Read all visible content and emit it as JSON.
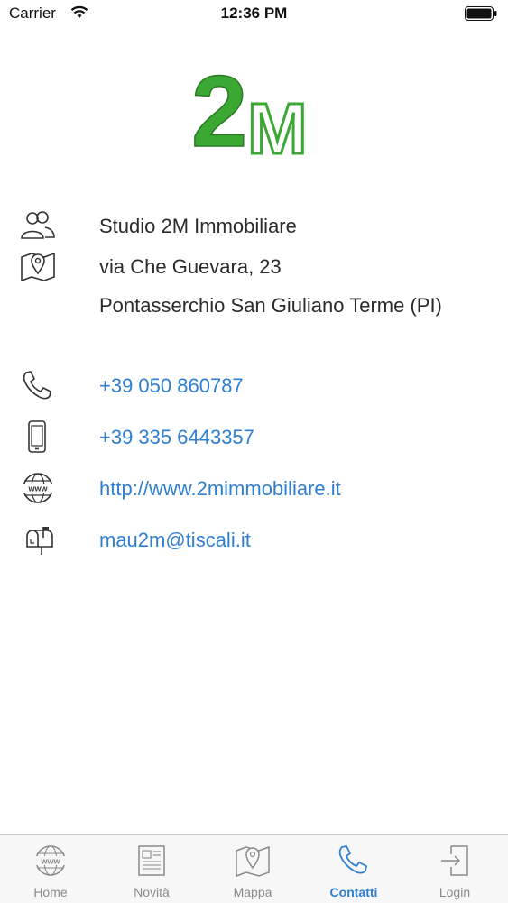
{
  "status_bar": {
    "carrier": "Carrier",
    "time": "12:36 PM"
  },
  "logo": {
    "text": "2M",
    "color": "#3aa832"
  },
  "contact": {
    "company": "Studio 2M Immobiliare",
    "address_line1": "via Che Guevara, 23",
    "address_line2": "Pontasserchio San Giuliano Terme (PI)",
    "phone": "+39 050 860787",
    "mobile": "+39 335 6443357",
    "website": "http://www.2mimmobiliare.it",
    "email": "mau2m@tiscali.it"
  },
  "icons": {
    "company": "people-icon",
    "address": "map-pin-icon",
    "phone": "phone-icon",
    "mobile": "smartphone-icon",
    "website": "globe-www-icon",
    "email": "mailbox-icon"
  },
  "tabs": [
    {
      "label": "Home",
      "icon": "globe-www-icon",
      "active": false
    },
    {
      "label": "Novità",
      "icon": "newspaper-icon",
      "active": false
    },
    {
      "label": "Mappa",
      "icon": "map-pin-icon",
      "active": false
    },
    {
      "label": "Contatti",
      "icon": "phone-icon",
      "active": true
    },
    {
      "label": "Login",
      "icon": "login-icon",
      "active": false
    }
  ],
  "colors": {
    "accent": "#2f7fd0",
    "brand_green": "#3aa832",
    "icon": "#333333"
  }
}
